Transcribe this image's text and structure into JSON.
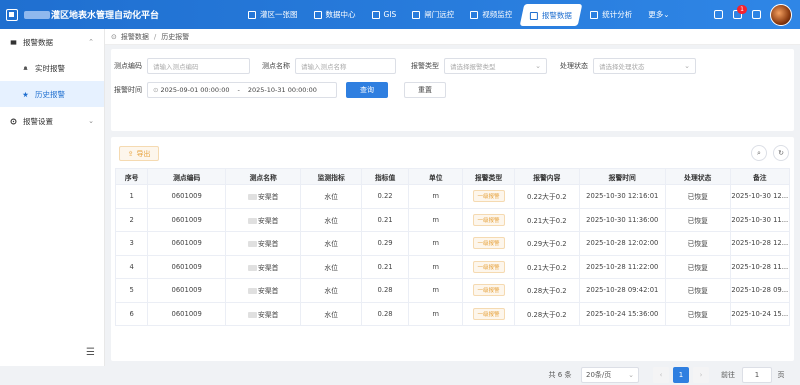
{
  "app": {
    "title_suffix": "灌区地表水管理自动化平台"
  },
  "nav": [
    {
      "label": "灌区一张图",
      "icon": "map-icon"
    },
    {
      "label": "数据中心",
      "icon": "monitor-icon"
    },
    {
      "label": "GIS",
      "icon": "gis-icon"
    },
    {
      "label": "闸门远控",
      "icon": "gate-icon"
    },
    {
      "label": "视频监控",
      "icon": "video-icon"
    },
    {
      "label": "报警数据",
      "icon": "alarm-icon",
      "active": true
    },
    {
      "label": "统计分析",
      "icon": "chart-icon"
    },
    {
      "label": "更多",
      "icon": "chevron-down-icon"
    }
  ],
  "topright": {
    "badge": "1"
  },
  "sidebar": {
    "group1": "报警数据",
    "sub1": "实时报警",
    "sub2": "历史报警",
    "group2": "报警设置"
  },
  "breadcrumb": {
    "root": "报警数据",
    "sep": "/",
    "current": "历史报警"
  },
  "search": {
    "code_label": "测点编码",
    "code_placeholder": "请输入测点编码",
    "name_label": "测点名称",
    "name_placeholder": "请输入测点名称",
    "type_label": "报警类型",
    "type_placeholder": "请选择报警类型",
    "status_label": "处理状态",
    "status_placeholder": "请选择处理状态",
    "time_label": "报警时间",
    "time_start": "2025-09-01 00:00:00",
    "time_sep": "-",
    "time_end": "2025-10-31 00:00:00",
    "query_button": "查询",
    "reset_button": "重置"
  },
  "toolbar": {
    "export_label": "导出"
  },
  "table": {
    "headers": [
      "序号",
      "测点编码",
      "测点名称",
      "监测指标",
      "指标值",
      "单位",
      "报警类型",
      "报警内容",
      "报警时间",
      "处理状态",
      "备注"
    ],
    "rows": [
      [
        "1",
        "0601009",
        "安渠首",
        "水位",
        "0.22",
        "m",
        "一级报警",
        "0.22大于0.2",
        "2025-10-30 12:16:01",
        "已恢复",
        "2025-10-30 12..."
      ],
      [
        "2",
        "0601009",
        "安渠首",
        "水位",
        "0.21",
        "m",
        "一级报警",
        "0.21大于0.2",
        "2025-10-30 11:36:00",
        "已恢复",
        "2025-10-30 11..."
      ],
      [
        "3",
        "0601009",
        "安渠首",
        "水位",
        "0.29",
        "m",
        "一级报警",
        "0.29大于0.2",
        "2025-10-28 12:02:00",
        "已恢复",
        "2025-10-28 12..."
      ],
      [
        "4",
        "0601009",
        "安渠首",
        "水位",
        "0.21",
        "m",
        "一级报警",
        "0.21大于0.2",
        "2025-10-28 11:22:00",
        "已恢复",
        "2025-10-28 11..."
      ],
      [
        "5",
        "0601009",
        "安渠首",
        "水位",
        "0.28",
        "m",
        "一级报警",
        "0.28大于0.2",
        "2025-10-28 09:42:01",
        "已恢复",
        "2025-10-28 09..."
      ],
      [
        "6",
        "0601009",
        "安渠首",
        "水位",
        "0.28",
        "m",
        "一级报警",
        "0.28大于0.2",
        "2025-10-24 15:36:00",
        "已恢复",
        "2025-10-24 15..."
      ]
    ]
  },
  "pagination": {
    "total": "共 6 条",
    "page_size": "20条/页",
    "current_page": "1",
    "goto_label": "前往",
    "goto_value": "1",
    "page_unit": "页",
    "prev": "‹",
    "next": "›"
  }
}
